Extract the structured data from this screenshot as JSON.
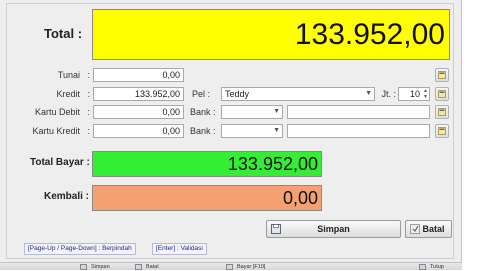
{
  "total": {
    "label": "Total :",
    "value": "133.952,00"
  },
  "tunai": {
    "label": "Tunai",
    "colon": ":",
    "value": "0,00"
  },
  "kredit": {
    "label": "Kredit",
    "colon": ":",
    "value": "133.952,00",
    "pel_label": "Pel :",
    "pel_value": "Teddy",
    "jt_label": "Jt. :",
    "jt_value": "10"
  },
  "kartu_debit": {
    "label": "Kartu Debit",
    "colon": ":",
    "value": "0,00",
    "bank_label": "Bank :"
  },
  "kartu_kredit": {
    "label": "Kartu Kredit",
    "colon": ":",
    "value": "0,00",
    "bank_label": "Bank :"
  },
  "total_bayar": {
    "label": "Total Bayar :",
    "value": "133.952,00"
  },
  "kembali": {
    "label": "Kembali :",
    "value": "0,00"
  },
  "buttons": {
    "simpan": "Simpan",
    "batal": "Batal"
  },
  "hints": {
    "navigate": "[Page-Up / Page-Down] : Berpindah",
    "validate": "[Enter] : Validasi"
  },
  "toolbar": {
    "item1": "Simpan",
    "item2": "Batal",
    "item3": "Bayar [F10]",
    "item4": "Tutup"
  },
  "colors": {
    "total_bg": "#ffff00",
    "total_bayar_bg": "#33ee33",
    "kembali_bg": "#f4a070"
  },
  "icons": {
    "mini_button": "calculator-icon",
    "simpan": "save-icon",
    "batal": "cancel-icon"
  }
}
